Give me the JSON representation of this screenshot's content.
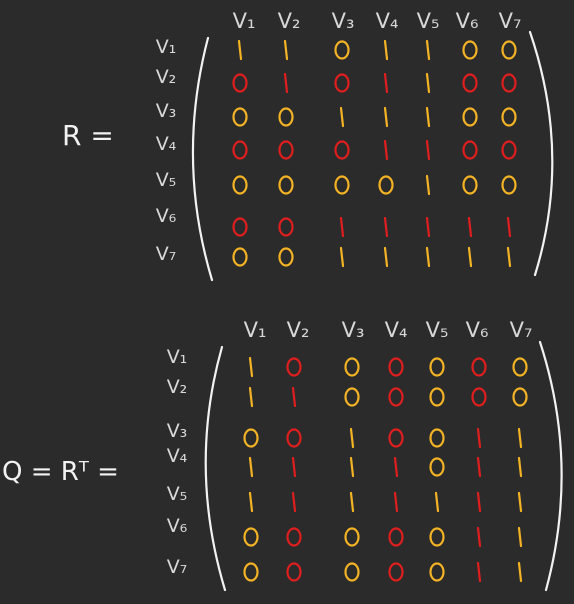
{
  "colors": {
    "background": "#2b2b2b",
    "ink": "#f2f2f2",
    "label": "#d8d8d8",
    "yellow": "#f3b325",
    "red": "#e01e1e"
  },
  "matrices": [
    {
      "name": "matrix-r",
      "label_text": "R =",
      "column_labels": [
        "V₁",
        "V₂",
        "V₃",
        "V₄",
        "V₅",
        "V₆",
        "V₇"
      ],
      "row_labels": [
        "V₁",
        "V₂",
        "V₃",
        "V₄",
        "V₅",
        "V₆",
        "V₇"
      ],
      "entries": [
        [
          "1",
          "1",
          "0",
          "1",
          "1",
          "0",
          "0"
        ],
        [
          "0",
          "1",
          "0",
          "1",
          "1",
          "0",
          "0"
        ],
        [
          "0",
          "0",
          "1",
          "1",
          "1",
          "0",
          "0"
        ],
        [
          "0",
          "0",
          "0",
          "1",
          "1",
          "0",
          "0"
        ],
        [
          "0",
          "0",
          "0",
          "0",
          "1",
          "0",
          "0"
        ],
        [
          "0",
          "0",
          "1",
          "1",
          "1",
          "1",
          "1"
        ],
        [
          "0",
          "0",
          "1",
          "1",
          "1",
          "1",
          "1"
        ]
      ],
      "entry_colors": [
        [
          "yellow",
          "yellow",
          "yellow",
          "yellow",
          "yellow",
          "yellow",
          "yellow"
        ],
        [
          "red",
          "red",
          "red",
          "red",
          "yellow",
          "red",
          "red"
        ],
        [
          "yellow",
          "yellow",
          "yellow",
          "yellow",
          "yellow",
          "yellow",
          "yellow"
        ],
        [
          "red",
          "red",
          "red",
          "red",
          "red",
          "red",
          "red"
        ],
        [
          "yellow",
          "yellow",
          "yellow",
          "yellow",
          "yellow",
          "yellow",
          "yellow"
        ],
        [
          "red",
          "red",
          "red",
          "red",
          "red",
          "red",
          "red"
        ],
        [
          "yellow",
          "yellow",
          "yellow",
          "yellow",
          "yellow",
          "yellow",
          "yellow"
        ]
      ]
    },
    {
      "name": "matrix-q",
      "label_text": "Q = Rᵀ =",
      "column_labels": [
        "V₁",
        "V₂",
        "V₃",
        "V₄",
        "V₅",
        "V₆",
        "V₇"
      ],
      "row_labels": [
        "V₁",
        "V₂",
        "V₃",
        "V₄",
        "V₅",
        "V₆",
        "V₇"
      ],
      "entries": [
        [
          "1",
          "0",
          "0",
          "0",
          "0",
          "0",
          "0"
        ],
        [
          "1",
          "1",
          "0",
          "0",
          "0",
          "0",
          "0"
        ],
        [
          "0",
          "0",
          "1",
          "0",
          "0",
          "1",
          "1"
        ],
        [
          "1",
          "1",
          "1",
          "1",
          "0",
          "1",
          "1"
        ],
        [
          "1",
          "1",
          "1",
          "1",
          "1",
          "1",
          "1"
        ],
        [
          "0",
          "0",
          "0",
          "0",
          "0",
          "1",
          "1"
        ],
        [
          "0",
          "0",
          "0",
          "0",
          "0",
          "1",
          "1"
        ]
      ],
      "entry_colors": [
        [
          "yellow",
          "red",
          "yellow",
          "red",
          "yellow",
          "red",
          "yellow"
        ],
        [
          "yellow",
          "red",
          "yellow",
          "red",
          "yellow",
          "red",
          "yellow"
        ],
        [
          "yellow",
          "red",
          "yellow",
          "red",
          "yellow",
          "red",
          "yellow"
        ],
        [
          "yellow",
          "red",
          "yellow",
          "red",
          "yellow",
          "red",
          "yellow"
        ],
        [
          "yellow",
          "red",
          "yellow",
          "red",
          "yellow",
          "red",
          "yellow"
        ],
        [
          "yellow",
          "red",
          "yellow",
          "red",
          "yellow",
          "red",
          "yellow"
        ],
        [
          "yellow",
          "red",
          "yellow",
          "red",
          "yellow",
          "red",
          "yellow"
        ]
      ]
    }
  ]
}
